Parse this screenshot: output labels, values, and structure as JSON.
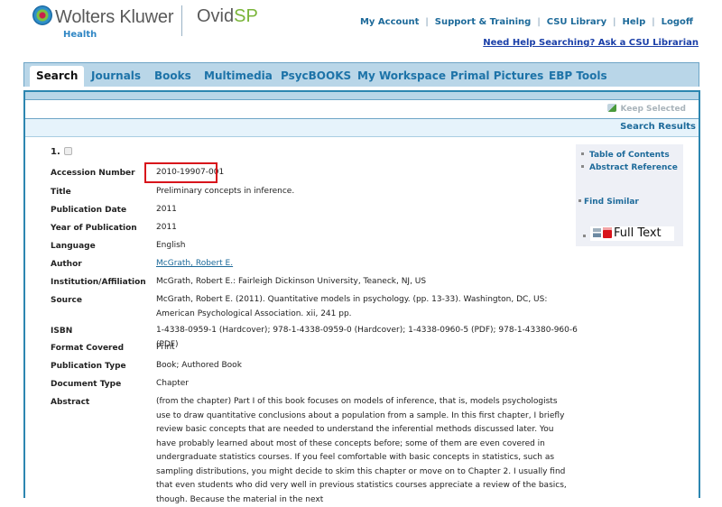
{
  "header": {
    "brand": "Wolters Kluwer",
    "brand_sub": "Health",
    "product_main": "Ovid",
    "product_accent": "SP",
    "links": [
      "My Account",
      "Support & Training",
      "CSU Library",
      "Help",
      "Logoff"
    ],
    "help_link": "Need Help Searching? Ask a CSU Librarian"
  },
  "tabs": [
    {
      "label": "Search",
      "active": true
    },
    {
      "label": "Journals"
    },
    {
      "label": "Books"
    },
    {
      "label": "Multimedia"
    },
    {
      "label": "PsycBOOKS"
    },
    {
      "label": "My Workspace"
    },
    {
      "label": "Primal Pictures"
    },
    {
      "label": "EBP Tools"
    }
  ],
  "toolbar": {
    "keep_selected": "Keep Selected",
    "search_results": "Search Results"
  },
  "record": {
    "number": "1.",
    "fields": [
      {
        "label": "Accession Number",
        "value": "2010-19907-001"
      },
      {
        "label": "Title",
        "value": "Preliminary concepts in inference."
      },
      {
        "label": "Publication Date",
        "value": "2011"
      },
      {
        "label": "Year of Publication",
        "value": "2011"
      },
      {
        "label": "Language",
        "value": "English"
      },
      {
        "label": "Author",
        "value": "McGrath, Robert E."
      },
      {
        "label": "Institution/Affiliation",
        "value": "McGrath, Robert E.: Fairleigh Dickinson University, Teaneck, NJ, US"
      },
      {
        "label": "Source",
        "value": "McGrath, Robert E. (2011). Quantitative models in psychology. (pp. 13-33). Washington, DC, US: American Psychological Association. xii, 241 pp."
      },
      {
        "label": "ISBN",
        "value": "1-4338-0959-1 (Hardcover); 978-1-4338-0959-0 (Hardcover); 1-4338-0960-5 (PDF); 978-1-43380-960-6 (PDF)"
      },
      {
        "label": "Format Covered",
        "value": "Print"
      },
      {
        "label": "Publication Type",
        "value": "Book; Authored Book"
      },
      {
        "label": "Document Type",
        "value": "Chapter"
      },
      {
        "label": "Abstract",
        "value": "(from the chapter) Part I of this book focuses on models of inference, that is, models psychologists use to draw quantitative conclusions about a population from a sample. In this first chapter, I briefly review basic concepts that are needed to understand the inferential methods discussed later. You have probably learned about most of these concepts before; some of them are even covered in undergraduate statistics courses. If you feel comfortable with basic concepts in statistics, such as sampling distributions, you might decide to skim this chapter or move on to Chapter 2. I usually find that even students who did very well in previous statistics courses appreciate a review of the basics, though. Because the material in the next"
      }
    ]
  },
  "sidebar": {
    "links": [
      "Table of Contents",
      "Abstract Reference",
      "Find Similar"
    ],
    "full_text": "Full Text"
  },
  "colors": {
    "link": "#1d6a9a",
    "tab_bar": "#b9d6e8",
    "panel_border": "#2d86b0",
    "highlight": "#d8141b",
    "brand_green": "#7ab539"
  }
}
